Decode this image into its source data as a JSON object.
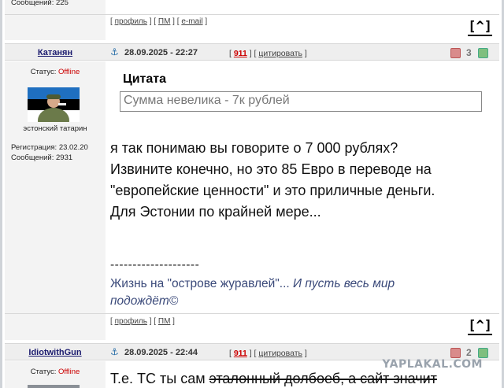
{
  "prev_post": {
    "messages_label": "Сообщений: 225",
    "links": [
      "профиль",
      "ПМ",
      "e-mail"
    ],
    "up_label": "[^]"
  },
  "post1": {
    "username": "Катанян",
    "date": "28.09.2025 - 22:27",
    "post_number": "911",
    "quote_action": "цитировать",
    "score": "3",
    "status_label": "Статус:",
    "status_value": "Offline",
    "user_title": "эстонский татарин",
    "registration": "Регистрация: 23.02.20",
    "messages": "Сообщений: 2931",
    "quote_title": "Цитата",
    "quote_text": "Сумма невелика - 7к рублей",
    "body_lines": [
      "я так понимаю вы говорите о 7 000 рублях?",
      "Извините конечно, но это 85 Евро в переводе на",
      "\"европейские ценности\" и это приличные деньги.",
      "Для Эстонии по крайней мере..."
    ],
    "sig_dashes": "--------------------",
    "sig_line1_a": "Жизнь на \"острове журавлей\"... ",
    "sig_line1_b": "И пусть весь мир",
    "sig_line2": "подождёт©",
    "links": [
      "профиль",
      "ПМ"
    ],
    "up_label": "[^]"
  },
  "post2": {
    "username": "IdiotwithGun",
    "date": "28.09.2025 - 22:44",
    "post_number": "911",
    "quote_action": "цитировать",
    "score": "2",
    "status_label": "Статус:",
    "status_value": "Offline",
    "body_line_a": "Т.е. ТС ты сам ",
    "body_line_b": "эталонный долбоеб, а сайт значит"
  },
  "watermark": "YAPLAKAL.COM",
  "colors": {
    "offline": "#cc0000",
    "post_number": "#cc0000",
    "signature": "#3b4a7a"
  }
}
